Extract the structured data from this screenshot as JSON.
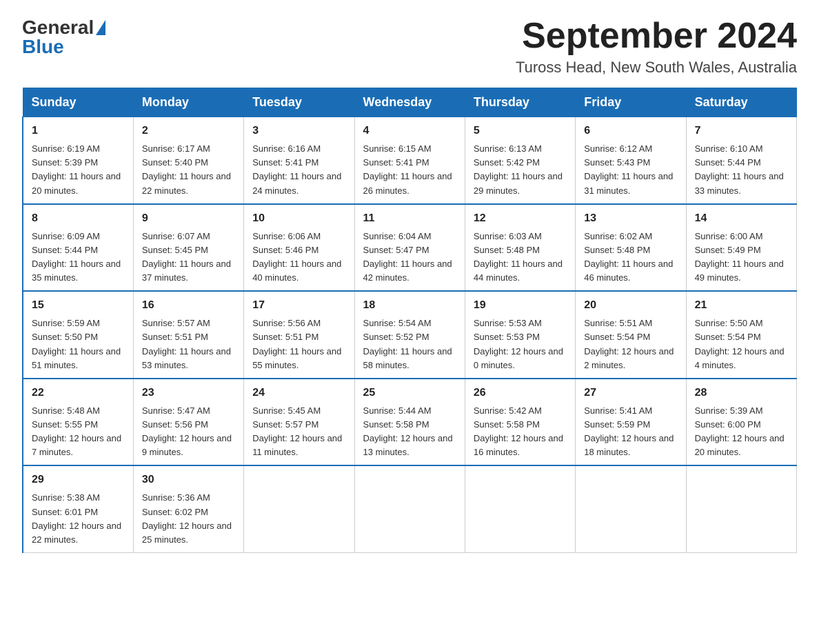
{
  "header": {
    "logo_general": "General",
    "logo_blue": "Blue",
    "month_year": "September 2024",
    "location": "Tuross Head, New South Wales, Australia"
  },
  "weekdays": [
    "Sunday",
    "Monday",
    "Tuesday",
    "Wednesday",
    "Thursday",
    "Friday",
    "Saturday"
  ],
  "weeks": [
    [
      {
        "day": "1",
        "sunrise": "6:19 AM",
        "sunset": "5:39 PM",
        "daylight": "11 hours and 20 minutes."
      },
      {
        "day": "2",
        "sunrise": "6:17 AM",
        "sunset": "5:40 PM",
        "daylight": "11 hours and 22 minutes."
      },
      {
        "day": "3",
        "sunrise": "6:16 AM",
        "sunset": "5:41 PM",
        "daylight": "11 hours and 24 minutes."
      },
      {
        "day": "4",
        "sunrise": "6:15 AM",
        "sunset": "5:41 PM",
        "daylight": "11 hours and 26 minutes."
      },
      {
        "day": "5",
        "sunrise": "6:13 AM",
        "sunset": "5:42 PM",
        "daylight": "11 hours and 29 minutes."
      },
      {
        "day": "6",
        "sunrise": "6:12 AM",
        "sunset": "5:43 PM",
        "daylight": "11 hours and 31 minutes."
      },
      {
        "day": "7",
        "sunrise": "6:10 AM",
        "sunset": "5:44 PM",
        "daylight": "11 hours and 33 minutes."
      }
    ],
    [
      {
        "day": "8",
        "sunrise": "6:09 AM",
        "sunset": "5:44 PM",
        "daylight": "11 hours and 35 minutes."
      },
      {
        "day": "9",
        "sunrise": "6:07 AM",
        "sunset": "5:45 PM",
        "daylight": "11 hours and 37 minutes."
      },
      {
        "day": "10",
        "sunrise": "6:06 AM",
        "sunset": "5:46 PM",
        "daylight": "11 hours and 40 minutes."
      },
      {
        "day": "11",
        "sunrise": "6:04 AM",
        "sunset": "5:47 PM",
        "daylight": "11 hours and 42 minutes."
      },
      {
        "day": "12",
        "sunrise": "6:03 AM",
        "sunset": "5:48 PM",
        "daylight": "11 hours and 44 minutes."
      },
      {
        "day": "13",
        "sunrise": "6:02 AM",
        "sunset": "5:48 PM",
        "daylight": "11 hours and 46 minutes."
      },
      {
        "day": "14",
        "sunrise": "6:00 AM",
        "sunset": "5:49 PM",
        "daylight": "11 hours and 49 minutes."
      }
    ],
    [
      {
        "day": "15",
        "sunrise": "5:59 AM",
        "sunset": "5:50 PM",
        "daylight": "11 hours and 51 minutes."
      },
      {
        "day": "16",
        "sunrise": "5:57 AM",
        "sunset": "5:51 PM",
        "daylight": "11 hours and 53 minutes."
      },
      {
        "day": "17",
        "sunrise": "5:56 AM",
        "sunset": "5:51 PM",
        "daylight": "11 hours and 55 minutes."
      },
      {
        "day": "18",
        "sunrise": "5:54 AM",
        "sunset": "5:52 PM",
        "daylight": "11 hours and 58 minutes."
      },
      {
        "day": "19",
        "sunrise": "5:53 AM",
        "sunset": "5:53 PM",
        "daylight": "12 hours and 0 minutes."
      },
      {
        "day": "20",
        "sunrise": "5:51 AM",
        "sunset": "5:54 PM",
        "daylight": "12 hours and 2 minutes."
      },
      {
        "day": "21",
        "sunrise": "5:50 AM",
        "sunset": "5:54 PM",
        "daylight": "12 hours and 4 minutes."
      }
    ],
    [
      {
        "day": "22",
        "sunrise": "5:48 AM",
        "sunset": "5:55 PM",
        "daylight": "12 hours and 7 minutes."
      },
      {
        "day": "23",
        "sunrise": "5:47 AM",
        "sunset": "5:56 PM",
        "daylight": "12 hours and 9 minutes."
      },
      {
        "day": "24",
        "sunrise": "5:45 AM",
        "sunset": "5:57 PM",
        "daylight": "12 hours and 11 minutes."
      },
      {
        "day": "25",
        "sunrise": "5:44 AM",
        "sunset": "5:58 PM",
        "daylight": "12 hours and 13 minutes."
      },
      {
        "day": "26",
        "sunrise": "5:42 AM",
        "sunset": "5:58 PM",
        "daylight": "12 hours and 16 minutes."
      },
      {
        "day": "27",
        "sunrise": "5:41 AM",
        "sunset": "5:59 PM",
        "daylight": "12 hours and 18 minutes."
      },
      {
        "day": "28",
        "sunrise": "5:39 AM",
        "sunset": "6:00 PM",
        "daylight": "12 hours and 20 minutes."
      }
    ],
    [
      {
        "day": "29",
        "sunrise": "5:38 AM",
        "sunset": "6:01 PM",
        "daylight": "12 hours and 22 minutes."
      },
      {
        "day": "30",
        "sunrise": "5:36 AM",
        "sunset": "6:02 PM",
        "daylight": "12 hours and 25 minutes."
      },
      null,
      null,
      null,
      null,
      null
    ]
  ],
  "labels": {
    "sunrise": "Sunrise:",
    "sunset": "Sunset:",
    "daylight": "Daylight:"
  }
}
